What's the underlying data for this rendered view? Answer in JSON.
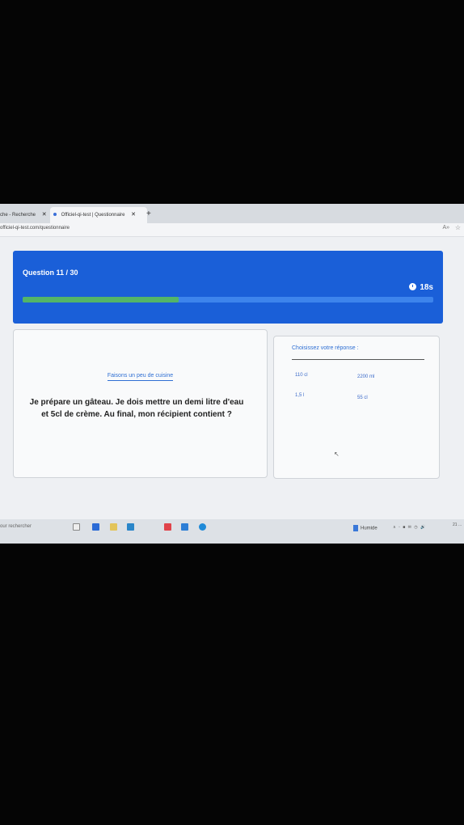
{
  "browser": {
    "tabs": [
      {
        "label": "che - Recherche",
        "close": "✕"
      },
      {
        "label": "Officiel-qi-test | Questionnaire",
        "close": "✕"
      }
    ],
    "new_tab": "+",
    "url": "officiel-qi-test.com/questionnaire",
    "read_icon": "A»",
    "star_icon": "☆"
  },
  "header": {
    "question_counter": "Question 11 / 30",
    "timer": "18s",
    "progress": 0.38,
    "colors": {
      "header": "#1a5fd8",
      "track": "#3d84ec",
      "fill": "#53b567"
    }
  },
  "question": {
    "category": "Faisons un peu de cuisine",
    "text": "Je prépare un gâteau. Je dois mettre un demi litre d'eau et 5cl de crème. Au final, mon récipient contient ?"
  },
  "answers": {
    "title": "Choisissez votre réponse :",
    "options": [
      "110 cl",
      "2200 ml",
      "1,5 l",
      "55 cl"
    ]
  },
  "taskbar": {
    "search": "our rechercher",
    "weather": "Humide",
    "tray": "∧ ◦ ■ ✉ ◷ 🔊",
    "clock": "21 ..."
  }
}
